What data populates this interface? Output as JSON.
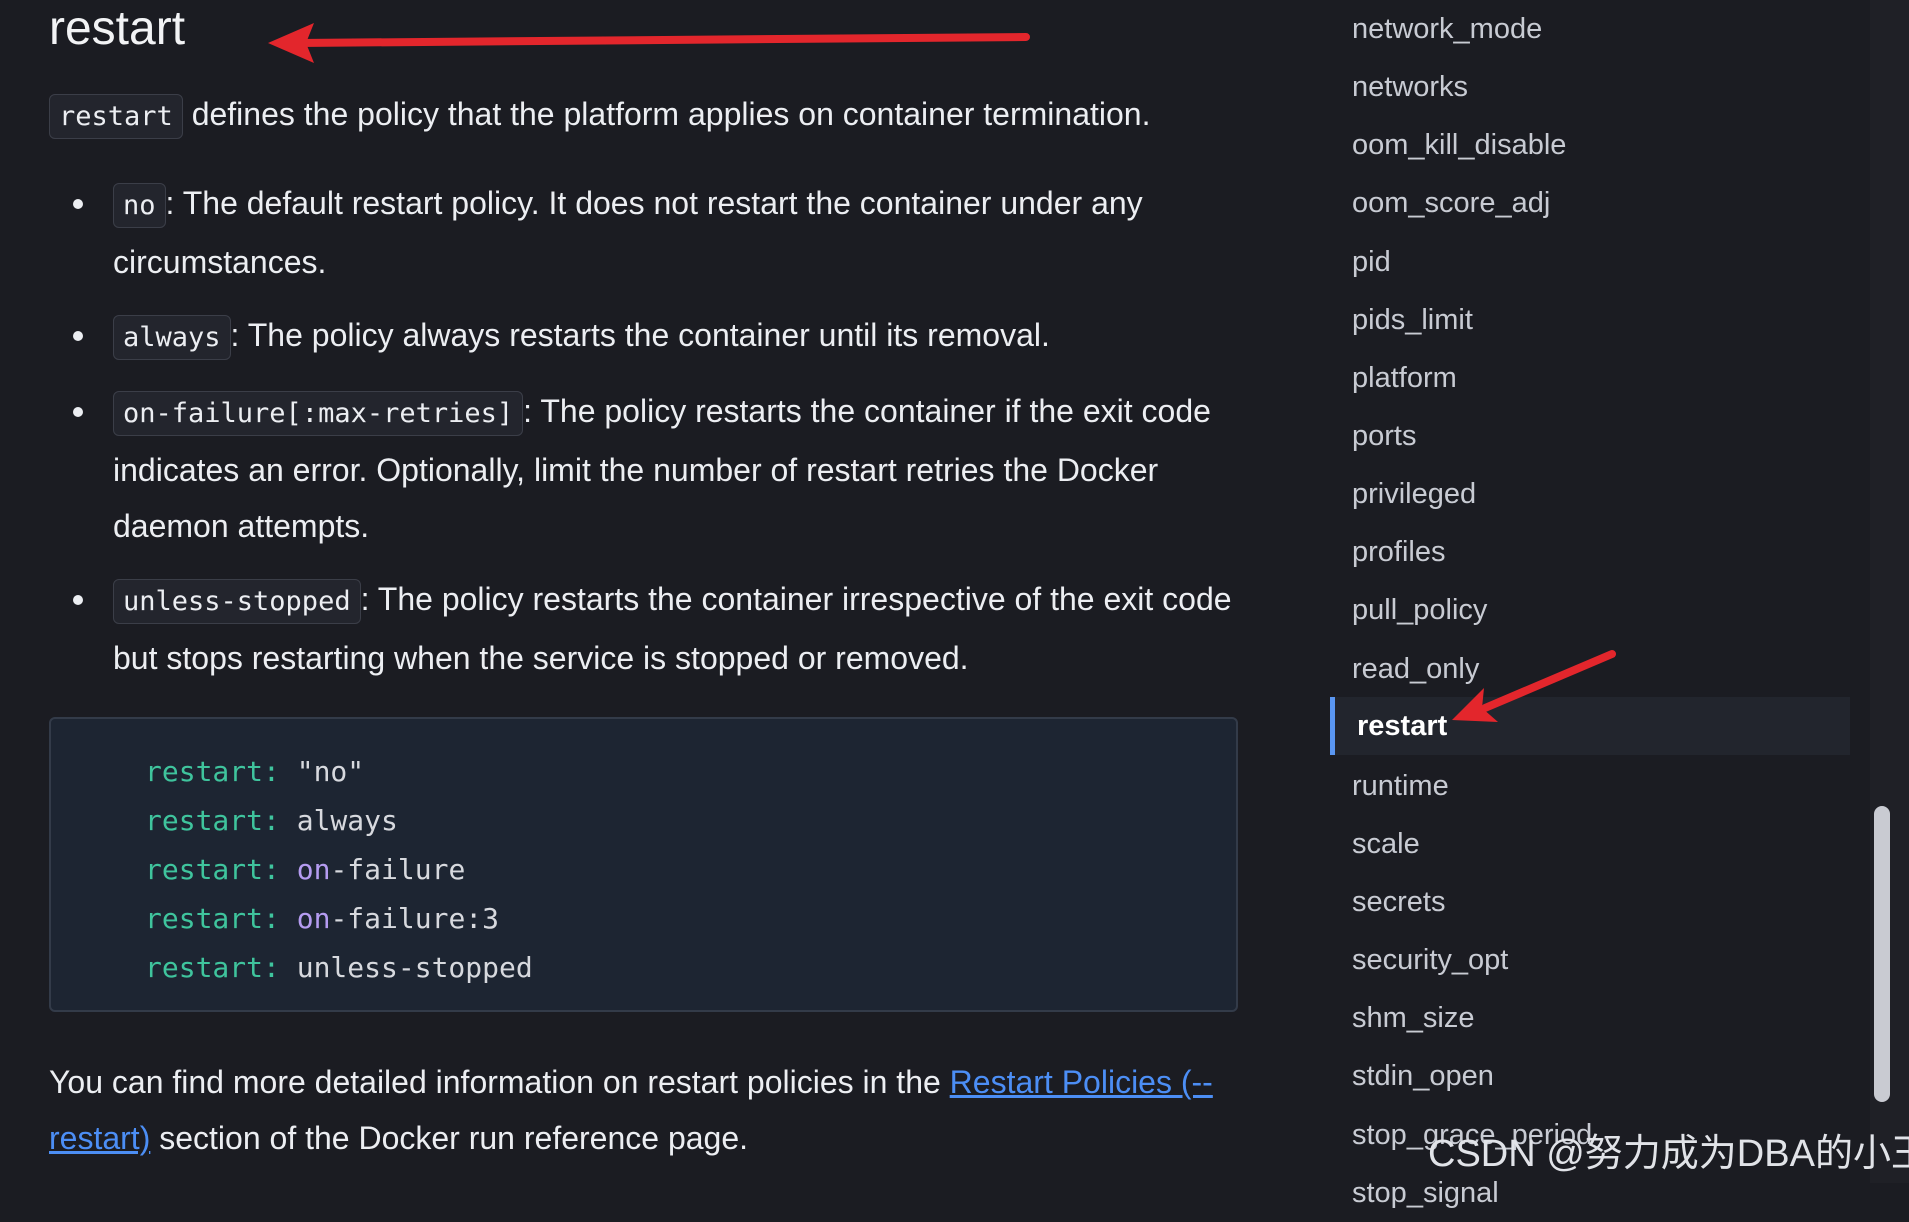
{
  "heading": "restart",
  "intro": {
    "code": "restart",
    "text": " defines the policy that the platform applies on container termination."
  },
  "options": [
    {
      "code": "no",
      "text": ": The default restart policy. It does not restart the container under any circumstances."
    },
    {
      "code": "always",
      "text": ": The policy always restarts the container until its removal."
    },
    {
      "code": "on-failure[:max-retries]",
      "text": ": The policy restarts the container if the exit code indicates an error. Optionally, limit the number of restart retries the Docker daemon attempts."
    },
    {
      "code": "unless-stopped",
      "text": ": The policy restarts the container irrespective of the exit code but stops restarting when the service is stopped or removed."
    }
  ],
  "code_block": [
    {
      "key": "restart:",
      "value": "\"no\"",
      "kw": "",
      "rest": ""
    },
    {
      "key": "restart:",
      "value": "always",
      "kw": "",
      "rest": ""
    },
    {
      "key": "restart:",
      "value": "",
      "kw": "on",
      "rest": "-failure"
    },
    {
      "key": "restart:",
      "value": "",
      "kw": "on",
      "rest": "-failure:3"
    },
    {
      "key": "restart:",
      "value": "unless-stopped",
      "kw": "",
      "rest": ""
    }
  ],
  "footer": {
    "before": "You can find more detailed information on restart policies in the ",
    "link": "Restart Policies (--restart)",
    "after": " section of the Docker run reference page."
  },
  "toc": {
    "items": [
      "network_mode",
      "networks",
      "oom_kill_disable",
      "oom_score_adj",
      "pid",
      "pids_limit",
      "platform",
      "ports",
      "privileged",
      "profiles",
      "pull_policy",
      "read_only",
      "restart",
      "runtime",
      "scale",
      "secrets",
      "security_opt",
      "shm_size",
      "stdin_open",
      "stop_grace_period",
      "stop_signal"
    ],
    "active": "restart"
  },
  "watermark": "CSDN @努力成为DBA的小王",
  "colors": {
    "annotation_arrow": "#e3262c",
    "link": "#4c8ef5",
    "active_marker": "#5a96f2"
  },
  "icons": {
    "annotation": "red-arrow-icon"
  }
}
